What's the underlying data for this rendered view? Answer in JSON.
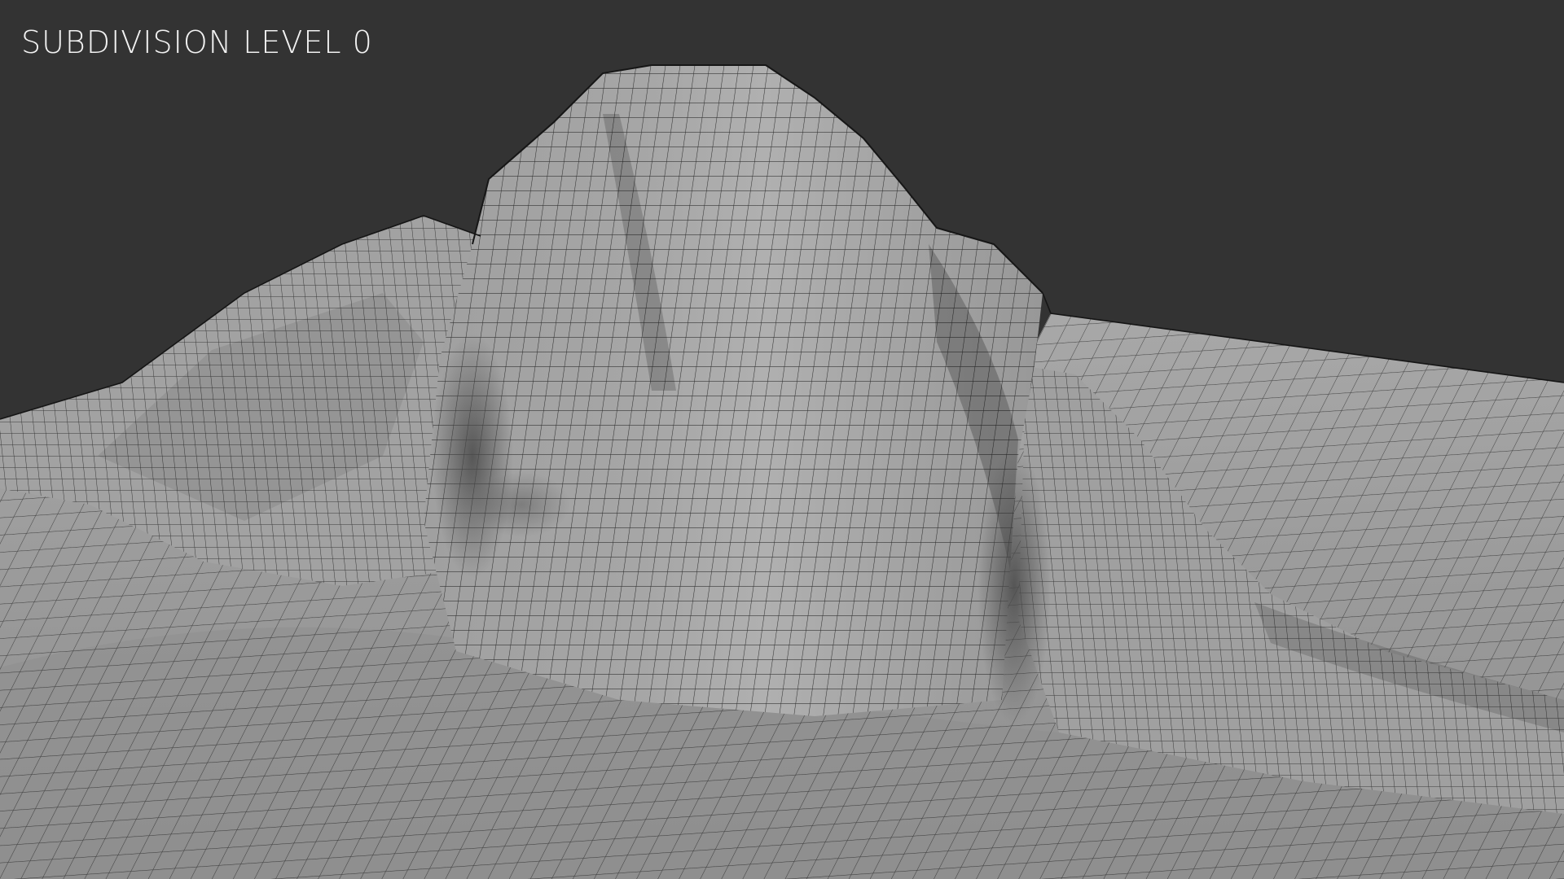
{
  "viewport": {
    "overlay_text": "SUBDIVISION LEVEL 0",
    "background_color": "#333333",
    "mesh_color": "#9c9c9c",
    "wire_color": "#1c1c1c",
    "subject": "sculpted-terrain-mesh-wireframe"
  }
}
